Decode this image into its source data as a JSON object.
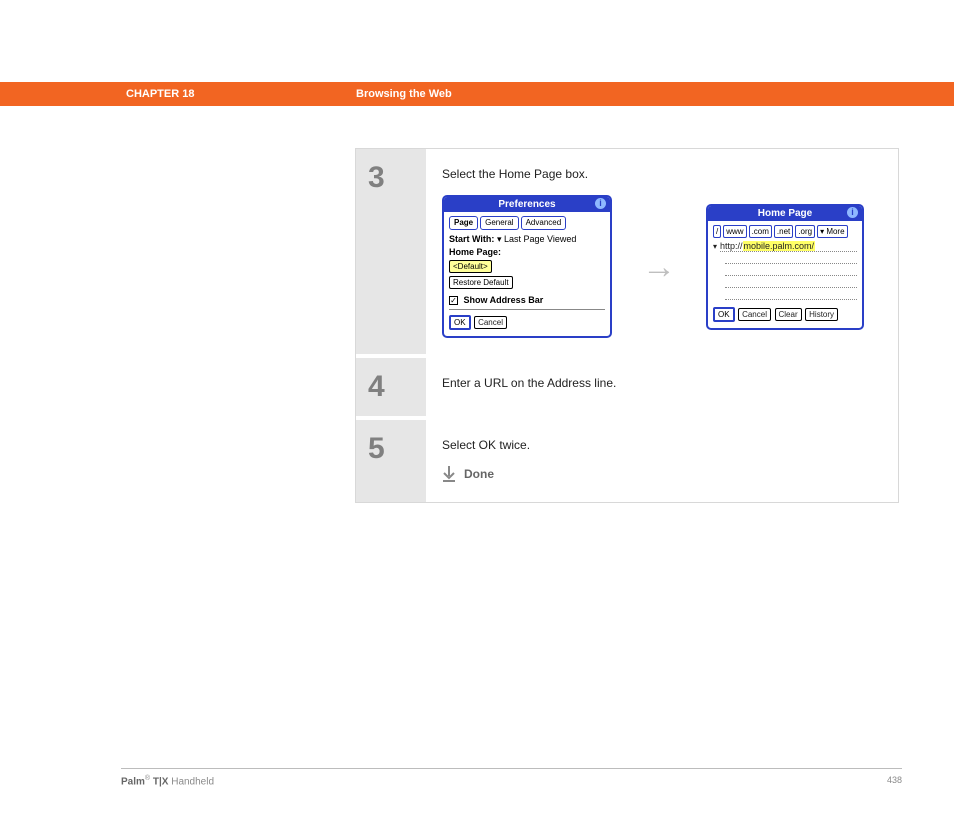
{
  "header": {
    "chapter": "CHAPTER 18",
    "title": "Browsing the Web"
  },
  "steps": {
    "s3": {
      "num": "3",
      "text": "Select the Home Page box."
    },
    "s4": {
      "num": "4",
      "text": "Enter a URL on the Address line."
    },
    "s5": {
      "num": "5",
      "text": "Select OK twice.",
      "done": "Done"
    }
  },
  "prefs": {
    "title": "Preferences",
    "tabs": {
      "page": "Page",
      "general": "General",
      "advanced": "Advanced"
    },
    "startWithLabel": "Start With:",
    "startWithValue": "Last Page Viewed",
    "homePageLabel": "Home Page:",
    "defaultBtn": "<Default>",
    "restoreBtn": "Restore Default",
    "showAddr": "Show Address Bar",
    "ok": "OK",
    "cancel": "Cancel"
  },
  "homepage": {
    "title": "Home Page",
    "shortcuts": {
      "slash": "/",
      "www": "www",
      "com": ".com",
      "net": ".net",
      "org": ".org",
      "more": "More"
    },
    "urlPrefix": "http://",
    "urlHighlighted": "mobile.palm.com/",
    "ok": "OK",
    "cancel": "Cancel",
    "clear": "Clear",
    "history": "History"
  },
  "footer": {
    "brandBold": "Palm",
    "brandRest": " T|X",
    "brandTail": " Handheld",
    "pageNum": "438"
  }
}
